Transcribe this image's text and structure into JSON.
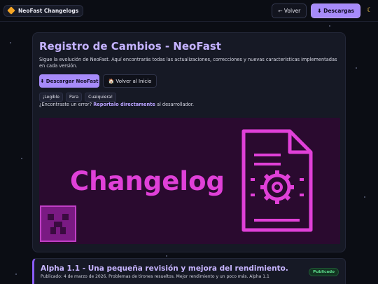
{
  "header": {
    "brand": "NeoFast Changelogs",
    "back_label": "← Volver",
    "download_label": "⬇ Descargas",
    "theme_icon": "moon-icon"
  },
  "main": {
    "title": "Registro de Cambios - NeoFast",
    "description": "Sigue la evolución de NeoFast. Aquí encontrarás todas las actualizaciones, correcciones y nuevas características implementadas en cada versión.",
    "primary_button": "⬇ Descargar NeoFast",
    "secondary_button": "🏠 Volver al Inicio",
    "tags": [
      "¡Legible",
      "Para",
      "Cualquiera!"
    ],
    "report_prefix": "¿Encontraste un error?",
    "report_link": "Reportalo directamente",
    "report_suffix": "al desarrollador.",
    "banner_text": "Changelog",
    "banner_colors": {
      "background": "#2a0a2f",
      "accent": "#e040d8",
      "tile": "#7a1a83"
    }
  },
  "entry": {
    "title": "Alpha 1.1 - Una pequeña revisión y mejora del rendimiento.",
    "meta": "Publicado: 4 de marzo de 2026. Problemas de tirones resueltos. Mejor rendimiento y un poco más. Alpha 1.1",
    "badge": "Publicado"
  },
  "colors": {
    "accent": "#a78bfa",
    "background": "#0b0d14",
    "card": "#161925",
    "success": "#5fe08f"
  }
}
